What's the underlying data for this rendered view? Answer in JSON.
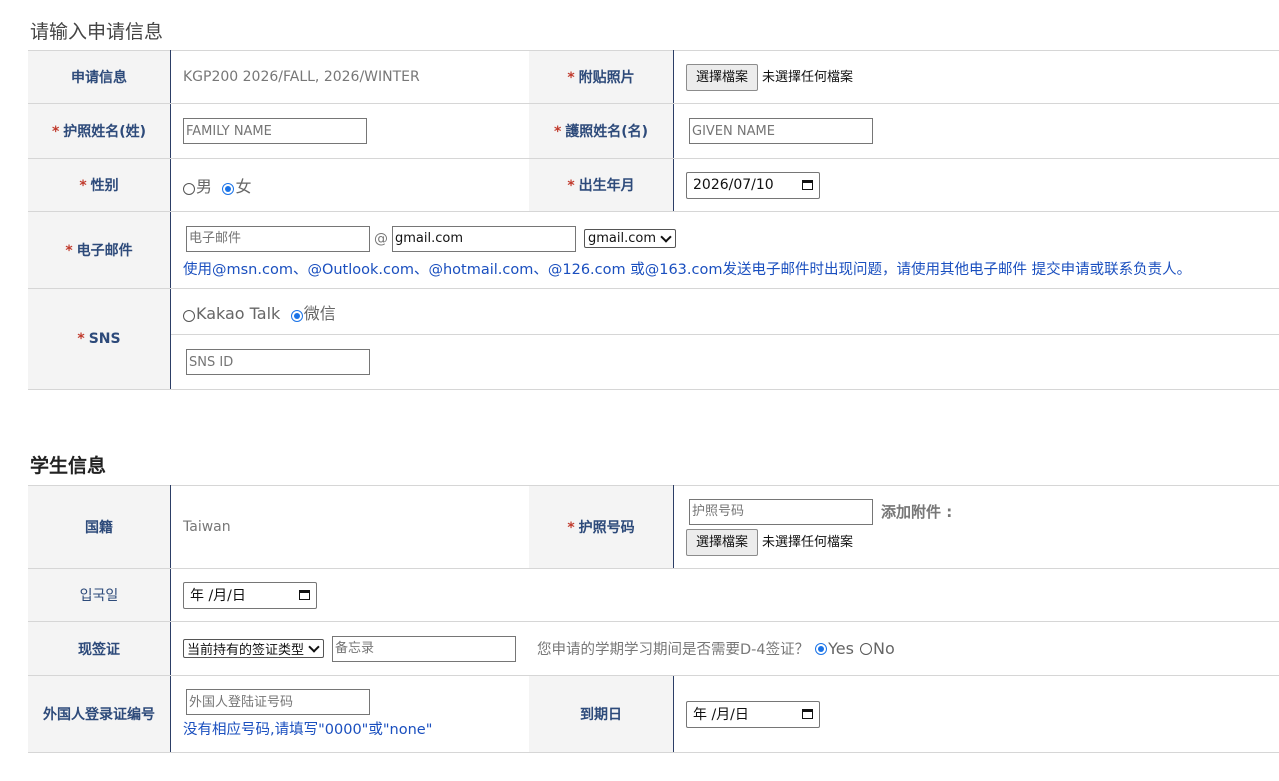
{
  "section1": {
    "title": "请输入申请信息",
    "application_info_label": "申请信息",
    "application_info_value": "KGP200 2026/FALL, 2026/WINTER",
    "photo_label": "附贴照片",
    "file_button": "選擇檔案",
    "no_file": "未選擇任何檔案",
    "surname_label": "护照姓名(姓)",
    "surname_placeholder": "FAMILY NAME",
    "given_label": "護照姓名(名)",
    "given_placeholder": "GIVEN NAME",
    "gender_label": "性别",
    "gender_male": "男",
    "gender_female": "女",
    "gender_selected": "女",
    "birth_label": "出生年月",
    "birth_value": "2026/07/10",
    "email_label": "电子邮件",
    "email_placeholder": "电子邮件",
    "email_at": "@",
    "email_domain_value": "gmail.com",
    "email_domain_select": "gmail.com",
    "email_notice": "使用@msn.com、@Outlook.com、@hotmail.com、@126.com 或@163.com发送电子邮件时出现问题，请使用其他电子邮件 提交申请或联系负责人。",
    "sns_label": "SNS",
    "sns_kakao": "Kakao Talk",
    "sns_wechat": "微信",
    "sns_selected": "微信",
    "sns_id_placeholder": "SNS ID"
  },
  "section2": {
    "title": "学生信息",
    "nationality_label": "国籍",
    "nationality_value": "Taiwan",
    "passport_label": "护照号码",
    "passport_placeholder": "护照号码",
    "attach_label": "添加附件 :",
    "file_button": "選擇檔案",
    "no_file": "未選擇任何檔案",
    "entry_label": "입국일",
    "entry_date": "年 /月/日",
    "visa_label": "现签证",
    "visa_select": "当前持有的签证类型",
    "visa_memo_placeholder": "备忘录",
    "d4_question": "您申请的学期学习期间是否需要D-4签证？",
    "d4_yes": "Yes",
    "d4_no": "No",
    "d4_selected": "Yes",
    "arc_label": "外国人登录证编号",
    "arc_placeholder": "外国人登陆证号码",
    "arc_note": "没有相应号码,请填写\"0000\"或\"none\"",
    "expiry_label": "到期日",
    "expiry_date": "年 /月/日"
  },
  "colors": {
    "label_text": "#2d4a7a",
    "required_star": "#c0392b",
    "notice_text": "#1a4fbf",
    "radio_selected": "#1a73e8"
  }
}
